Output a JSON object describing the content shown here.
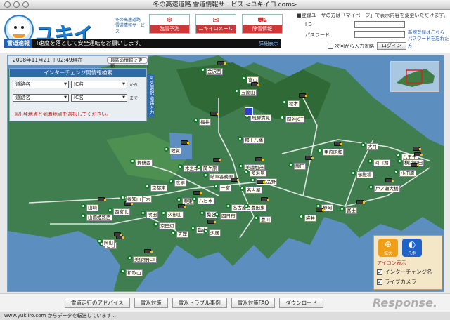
{
  "window": {
    "title": "冬の高速道路 雪道情報サービス <ユキイロ.com>"
  },
  "header": {
    "logo": "ユキイロ.com",
    "logo_sub1": "冬の高速道路",
    "logo_sub2": "雪道情報サービス",
    "nav": [
      {
        "label": "臨雪予測",
        "icon": "snowflake-icon"
      },
      {
        "label": "ユキイロメール",
        "icon": "mail-icon"
      },
      {
        "label": "除雪情報",
        "icon": "truck-icon"
      }
    ],
    "ticker": {
      "tag": "雪道速報",
      "text": "!速度を落として安全運転をお願いします。",
      "more": "詳細表示"
    }
  },
  "login": {
    "note": "■登録ユーザの方は「マイページ」で表示内容を変更いただけます。",
    "id_label": "I D",
    "password_label": "パスワード",
    "id_value": "",
    "password_value": "",
    "link_register": "新規登録はこちら",
    "link_forgot": "パスワードを忘れた方",
    "remember_label": "次回から入力省略",
    "login_button": "ログイン"
  },
  "map": {
    "timestamp": "2008年11月21日 02:49現在",
    "refresh_label": "最新の情報に更新",
    "panel_title": "インターチェンジ間情報検索",
    "row1": {
      "road": "道路名",
      "ic": "IC名",
      "sep": "から"
    },
    "row2": {
      "road": "道路名",
      "ic": "IC名",
      "sep": "まで"
    },
    "warning": "※出発地点と到着地点を選択してください。",
    "side_tab": "IC名選択 道路入力",
    "legend": {
      "zoom_label": "拡大",
      "legend_label": "凡例",
      "title": "アイコン表示",
      "opt_ic": "インターチェンジ名",
      "opt_cam": "ライブカメラ"
    },
    "places": [
      {
        "name": "金沢西"
      },
      {
        "name": "富山"
      },
      {
        "name": "五箇山"
      },
      {
        "name": "飛騨清見"
      },
      {
        "name": "松本"
      },
      {
        "name": "岡谷JCT"
      },
      {
        "name": "福井"
      },
      {
        "name": "郡上八幡"
      },
      {
        "name": "八王子"
      },
      {
        "name": "大月"
      },
      {
        "name": "甲府昭和"
      },
      {
        "name": "舞鶴西"
      },
      {
        "name": "敦賀"
      },
      {
        "name": "木之本"
      },
      {
        "name": "関ケ原"
      },
      {
        "name": "岐阜各務原"
      },
      {
        "name": "美濃加茂"
      },
      {
        "name": "多治見"
      },
      {
        "name": "飯田"
      },
      {
        "name": "河口湖"
      },
      {
        "name": "横浜町田"
      },
      {
        "name": "御殿場"
      },
      {
        "name": "小田原"
      },
      {
        "name": "京都東"
      },
      {
        "name": "一宮"
      },
      {
        "name": "せと品野"
      },
      {
        "name": "名古屋"
      },
      {
        "name": "彦根"
      },
      {
        "name": "戸ノ瀬大橋"
      },
      {
        "name": "三木"
      },
      {
        "name": "西宮北"
      },
      {
        "name": "福知山"
      },
      {
        "name": "山崎"
      },
      {
        "name": "山陽姫路西"
      },
      {
        "name": "栗東"
      },
      {
        "name": "八日市"
      },
      {
        "name": "亀山"
      },
      {
        "name": "桑名"
      },
      {
        "name": "四日市"
      },
      {
        "name": "名古屋西"
      },
      {
        "name": "豊田東"
      },
      {
        "name": "豊川"
      },
      {
        "name": "富士"
      },
      {
        "name": "静岡"
      },
      {
        "name": "袋井"
      },
      {
        "name": "天理"
      },
      {
        "name": "名谷"
      },
      {
        "name": "京田辺"
      },
      {
        "name": "久御山"
      },
      {
        "name": "吹田"
      },
      {
        "name": "岡山"
      },
      {
        "name": "久居"
      },
      {
        "name": "美保野JCT"
      },
      {
        "name": "和歌山"
      }
    ]
  },
  "footer": {
    "buttons": [
      "雪道走行のアドバイス",
      "雪氷対策",
      "雪氷トラブル事例",
      "雪氷対策FAQ",
      "ダウンロード"
    ],
    "status": "www.yukiiro.com からデータを転送しています...",
    "watermark": "Response."
  }
}
